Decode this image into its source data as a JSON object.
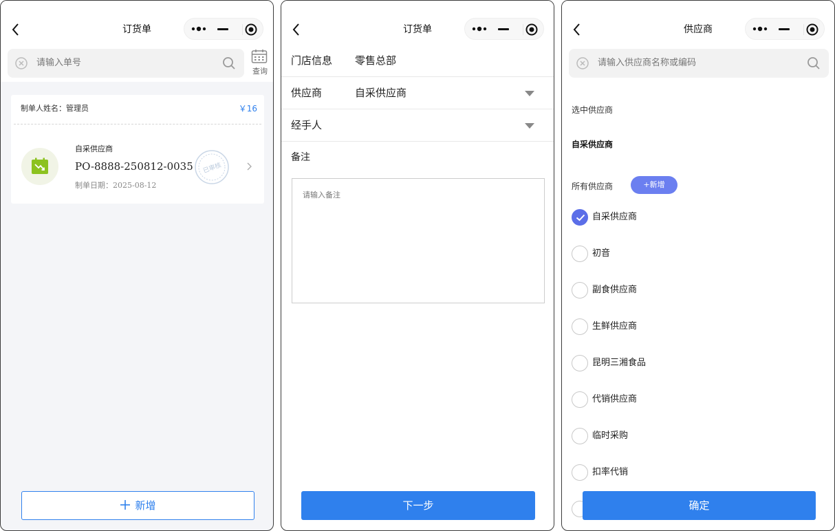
{
  "panel1": {
    "title": "订货单",
    "search_placeholder": "请输入单号",
    "query_label": "查询",
    "order": {
      "maker": "制单人姓名：管理员",
      "amount": "￥16",
      "supplier": "自采供应商",
      "po_number": "PO-8888-250812-0035",
      "date": "制单日期：2025-08-12",
      "stamp_text": "已审核"
    },
    "add_button": "新增"
  },
  "panel2": {
    "title": "订货单",
    "store_label": "门店信息",
    "store_value": "零售总部",
    "supplier_label": "供应商",
    "supplier_value": "自采供应商",
    "handler_label": "经手人",
    "handler_value": "",
    "remark_label": "备注",
    "remark_placeholder": "请输入备注",
    "next_button": "下一步"
  },
  "panel3": {
    "title": "供应商",
    "search_placeholder": "请输入供应商名称或编码",
    "selected_label": "选中供应商",
    "selected_value": "自采供应商",
    "all_label": "所有供应商",
    "add_button": "+新增",
    "suppliers": [
      {
        "name": "自采供应商",
        "checked": true
      },
      {
        "name": "初音",
        "checked": false
      },
      {
        "name": "副食供应商",
        "checked": false
      },
      {
        "name": "生鲜供应商",
        "checked": false
      },
      {
        "name": "昆明三湘食品",
        "checked": false
      },
      {
        "name": "代销供应商",
        "checked": false
      },
      {
        "name": "临时采购",
        "checked": false
      },
      {
        "name": "扣率代销",
        "checked": false
      },
      {
        "name": "",
        "checked": false
      }
    ],
    "confirm_button": "确定"
  },
  "colors": {
    "primary": "#2f80ed",
    "accent": "#5b6ee8",
    "add_pill": "#6b7ff0",
    "supplier_icon": "#8cc21f"
  }
}
